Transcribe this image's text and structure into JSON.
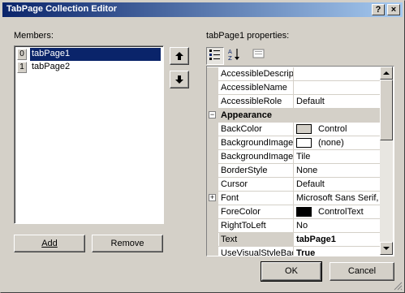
{
  "window": {
    "title": "TabPage Collection Editor",
    "help_label": "?",
    "close_label": "×"
  },
  "members": {
    "label": "Members:",
    "items": [
      {
        "index": "0",
        "name": "tabPage1",
        "selected": true
      },
      {
        "index": "1",
        "name": "tabPage2",
        "selected": false
      }
    ],
    "move_up_icon": "up-arrow-icon",
    "move_down_icon": "down-arrow-icon",
    "add_label": "Add",
    "remove_label": "Remove"
  },
  "properties": {
    "label": "tabPage1 properties:",
    "toolbar": {
      "categorized_icon": "categorized-icon",
      "alphabetical_icon": "alphabetical-icon",
      "property_pages_icon": "property-pages-icon"
    },
    "rows": [
      {
        "name": "AccessibleDescript",
        "value": "",
        "kind": "prop"
      },
      {
        "name": "AccessibleName",
        "value": "",
        "kind": "prop"
      },
      {
        "name": "AccessibleRole",
        "value": "Default",
        "kind": "prop"
      },
      {
        "name": "Appearance",
        "value": "",
        "kind": "category"
      },
      {
        "name": "BackColor",
        "value": "Control",
        "kind": "prop",
        "swatch": "#d4d0c8"
      },
      {
        "name": "BackgroundImage",
        "value": "(none)",
        "kind": "prop",
        "swatch": "#ffffff"
      },
      {
        "name": "BackgroundImageL",
        "value": "Tile",
        "kind": "prop"
      },
      {
        "name": "BorderStyle",
        "value": "None",
        "kind": "prop"
      },
      {
        "name": "Cursor",
        "value": "Default",
        "kind": "prop"
      },
      {
        "name": "Font",
        "value": "Microsoft Sans Serif,",
        "kind": "prop",
        "expandable": true
      },
      {
        "name": "ForeColor",
        "value": "ControlText",
        "kind": "prop",
        "swatch": "#000000"
      },
      {
        "name": "RightToLeft",
        "value": "No",
        "kind": "prop"
      },
      {
        "name": "Text",
        "value": "tabPage1",
        "kind": "prop",
        "selected": true
      },
      {
        "name": "UseVisualStyleBac",
        "value": "True",
        "kind": "prop"
      }
    ]
  },
  "footer": {
    "ok_label": "OK",
    "cancel_label": "Cancel"
  }
}
